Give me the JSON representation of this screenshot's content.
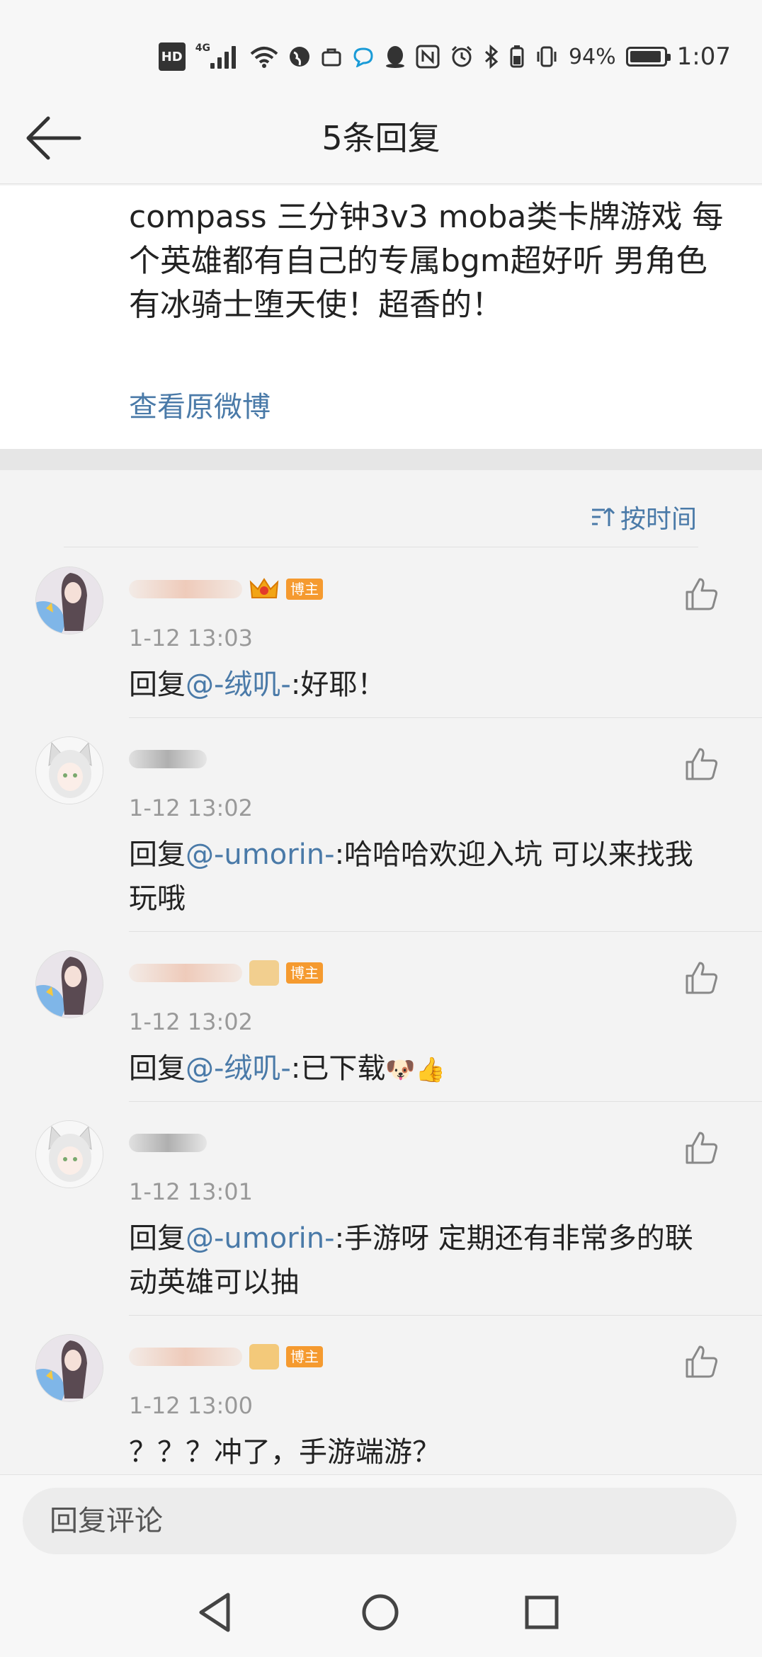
{
  "status_bar": {
    "network": "4G",
    "hd": "HD",
    "battery_percent": "94%",
    "battery_level": 0.94,
    "time": "1:07"
  },
  "header": {
    "title": "5条回复",
    "back_icon": "arrow-left-icon"
  },
  "original_post": {
    "text": "compass 三分钟3v3 moba类卡牌游戏 每个英雄都有自己的专属bgm超好听 男角色有冰骑士堕天使！超香的！",
    "link_label": "查看原微博"
  },
  "sort": {
    "label": "按时间",
    "icon": "sort-icon"
  },
  "replies": [
    {
      "time": "1-12 13:03",
      "prefix": "回复",
      "mention": "@-绒叽-",
      "text": ":好耶！",
      "badge": "博主",
      "avatar": "anime-girl"
    },
    {
      "time": "1-12 13:02",
      "prefix": "回复",
      "mention": "@-umorin-",
      "text": ":哈哈哈欢迎入坑 可以来找我玩哦",
      "badge": "",
      "avatar": "cat-girl"
    },
    {
      "time": "1-12 13:02",
      "prefix": "回复",
      "mention": "@-绒叽-",
      "text": ":已下载",
      "emoji1": "🐶",
      "emoji2": "👍",
      "badge": "博主",
      "avatar": "anime-girl"
    },
    {
      "time": "1-12 13:01",
      "prefix": "回复",
      "mention": "@-umorin-",
      "text": ":手游呀 定期还有非常多的联动英雄可以抽",
      "badge": "",
      "avatar": "cat-girl"
    },
    {
      "time": "1-12 13:00",
      "prefix": "",
      "mention": "",
      "text": "？？？冲了，手游端游？",
      "badge": "博主",
      "avatar": "anime-girl"
    }
  ],
  "reply_input": {
    "placeholder": "回复评论"
  },
  "colors": {
    "link": "#4a7aa8",
    "badge": "#f59a2f",
    "muted": "#999999"
  }
}
